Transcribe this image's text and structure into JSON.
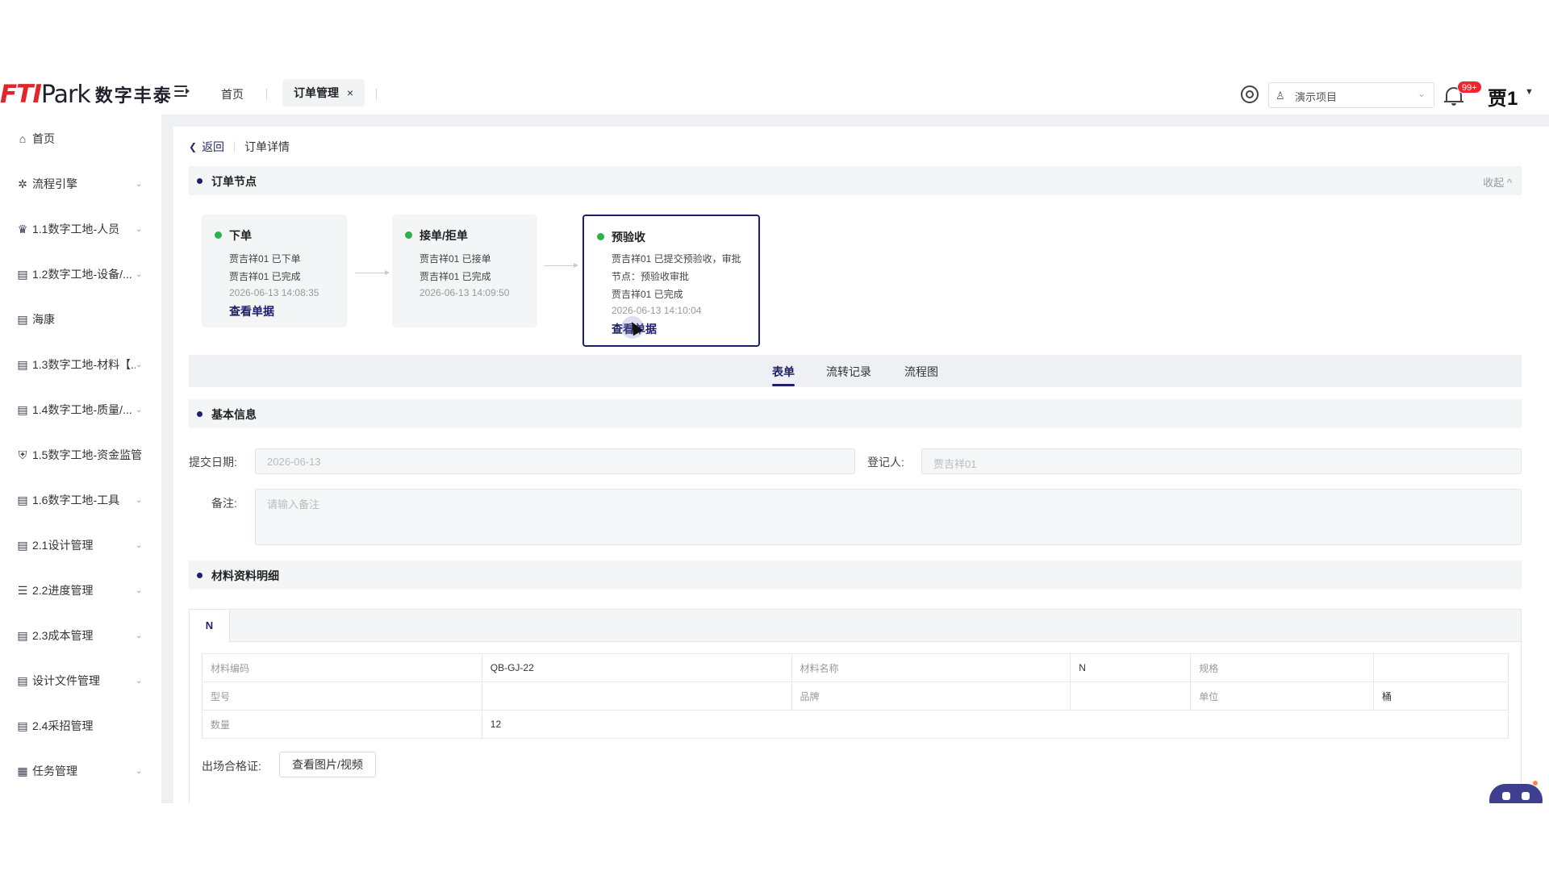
{
  "header": {
    "logo_ft": "FTI",
    "logo_park": "Park",
    "logo_cn": "数字丰泰",
    "tabs": [
      {
        "label": "首页"
      },
      {
        "label": "订单管理",
        "close": "×"
      }
    ],
    "project": "演示项目",
    "badge": "99+",
    "user": "贾1"
  },
  "sidebar": {
    "items": [
      {
        "label": "首页",
        "icon": "⌂"
      },
      {
        "label": "流程引擎",
        "icon": "✲",
        "caret": "⌄"
      },
      {
        "label": "1.1数字工地-人员",
        "icon": "♛",
        "caret": "⌄"
      },
      {
        "label": "1.2数字工地-设备/...",
        "icon": "▤",
        "caret": "⌄"
      },
      {
        "label": "海康",
        "icon": "▤"
      },
      {
        "label": "1.3数字工地-材料【...",
        "icon": "▤",
        "caret": "⌄"
      },
      {
        "label": "1.4数字工地-质量/...",
        "icon": "▤",
        "caret": "⌄"
      },
      {
        "label": "1.5数字工地-资金监管",
        "icon": "⛨"
      },
      {
        "label": "1.6数字工地-工具",
        "icon": "▤",
        "caret": "⌄"
      },
      {
        "label": "2.1设计管理",
        "icon": "▤",
        "caret": "⌄"
      },
      {
        "label": "2.2进度管理",
        "icon": "☰",
        "caret": "⌄"
      },
      {
        "label": "2.3成本管理",
        "icon": "▤",
        "caret": "⌄"
      },
      {
        "label": "设计文件管理",
        "icon": "▤",
        "caret": "⌄"
      },
      {
        "label": "2.4采招管理",
        "icon": "▤"
      },
      {
        "label": "任务管理",
        "icon": "▦",
        "caret": "⌄"
      }
    ]
  },
  "breadcrumb": {
    "back": "返回",
    "current": "订单详情"
  },
  "nodes_section": {
    "title": "订单节点",
    "collapse": "收起 ^"
  },
  "steps": [
    {
      "title": "下单",
      "lines": [
        "贾吉祥01 已下单",
        "贾吉祥01 已完成"
      ],
      "time": "2026-06-13 14:08:35",
      "link": "查看单据"
    },
    {
      "title": "接单/拒单",
      "lines": [
        "贾吉祥01 已接单",
        "贾吉祥01 已完成"
      ],
      "time": "2026-06-13 14:09:50"
    },
    {
      "title": "预验收",
      "lines": [
        "贾吉祥01 已提交预验收，审批",
        "节点：预验收审批",
        "贾吉祥01 已完成"
      ],
      "time": "2026-06-13 14:10:04",
      "link": "查看单据"
    }
  ],
  "tabs": [
    {
      "label": "表单",
      "active": true
    },
    {
      "label": "流转记录"
    },
    {
      "label": "流程图"
    }
  ],
  "basic": {
    "title": "基本信息",
    "submit_date_label": "提交日期:",
    "submit_date": "2026-06-13",
    "registrant_label": "登记人:",
    "registrant": "贾吉祥01",
    "remark_label": "备注:",
    "remark_placeholder": "请输入备注"
  },
  "material": {
    "title": "材料资料明细",
    "tab": "N",
    "rows": [
      [
        {
          "k": "材料编码"
        },
        {
          "v": "QB-GJ-22"
        },
        {
          "k": "材料名称"
        },
        {
          "v": "N"
        },
        {
          "k": "规格"
        },
        {
          "v": ""
        }
      ],
      [
        {
          "k": "型号"
        },
        {
          "v": ""
        },
        {
          "k": "品牌"
        },
        {
          "v": ""
        },
        {
          "k": "单位"
        },
        {
          "v": "桶"
        }
      ],
      [
        {
          "k": "数量"
        },
        {
          "v": "12"
        }
      ]
    ],
    "cert_label": "出场合格证:",
    "cert_button": "查看图片/视频"
  },
  "colors": {
    "accent": "#1e1e6e",
    "logo_red": "#e0262b",
    "status_green": "#2bb24c",
    "badge_red": "#f5222d"
  }
}
